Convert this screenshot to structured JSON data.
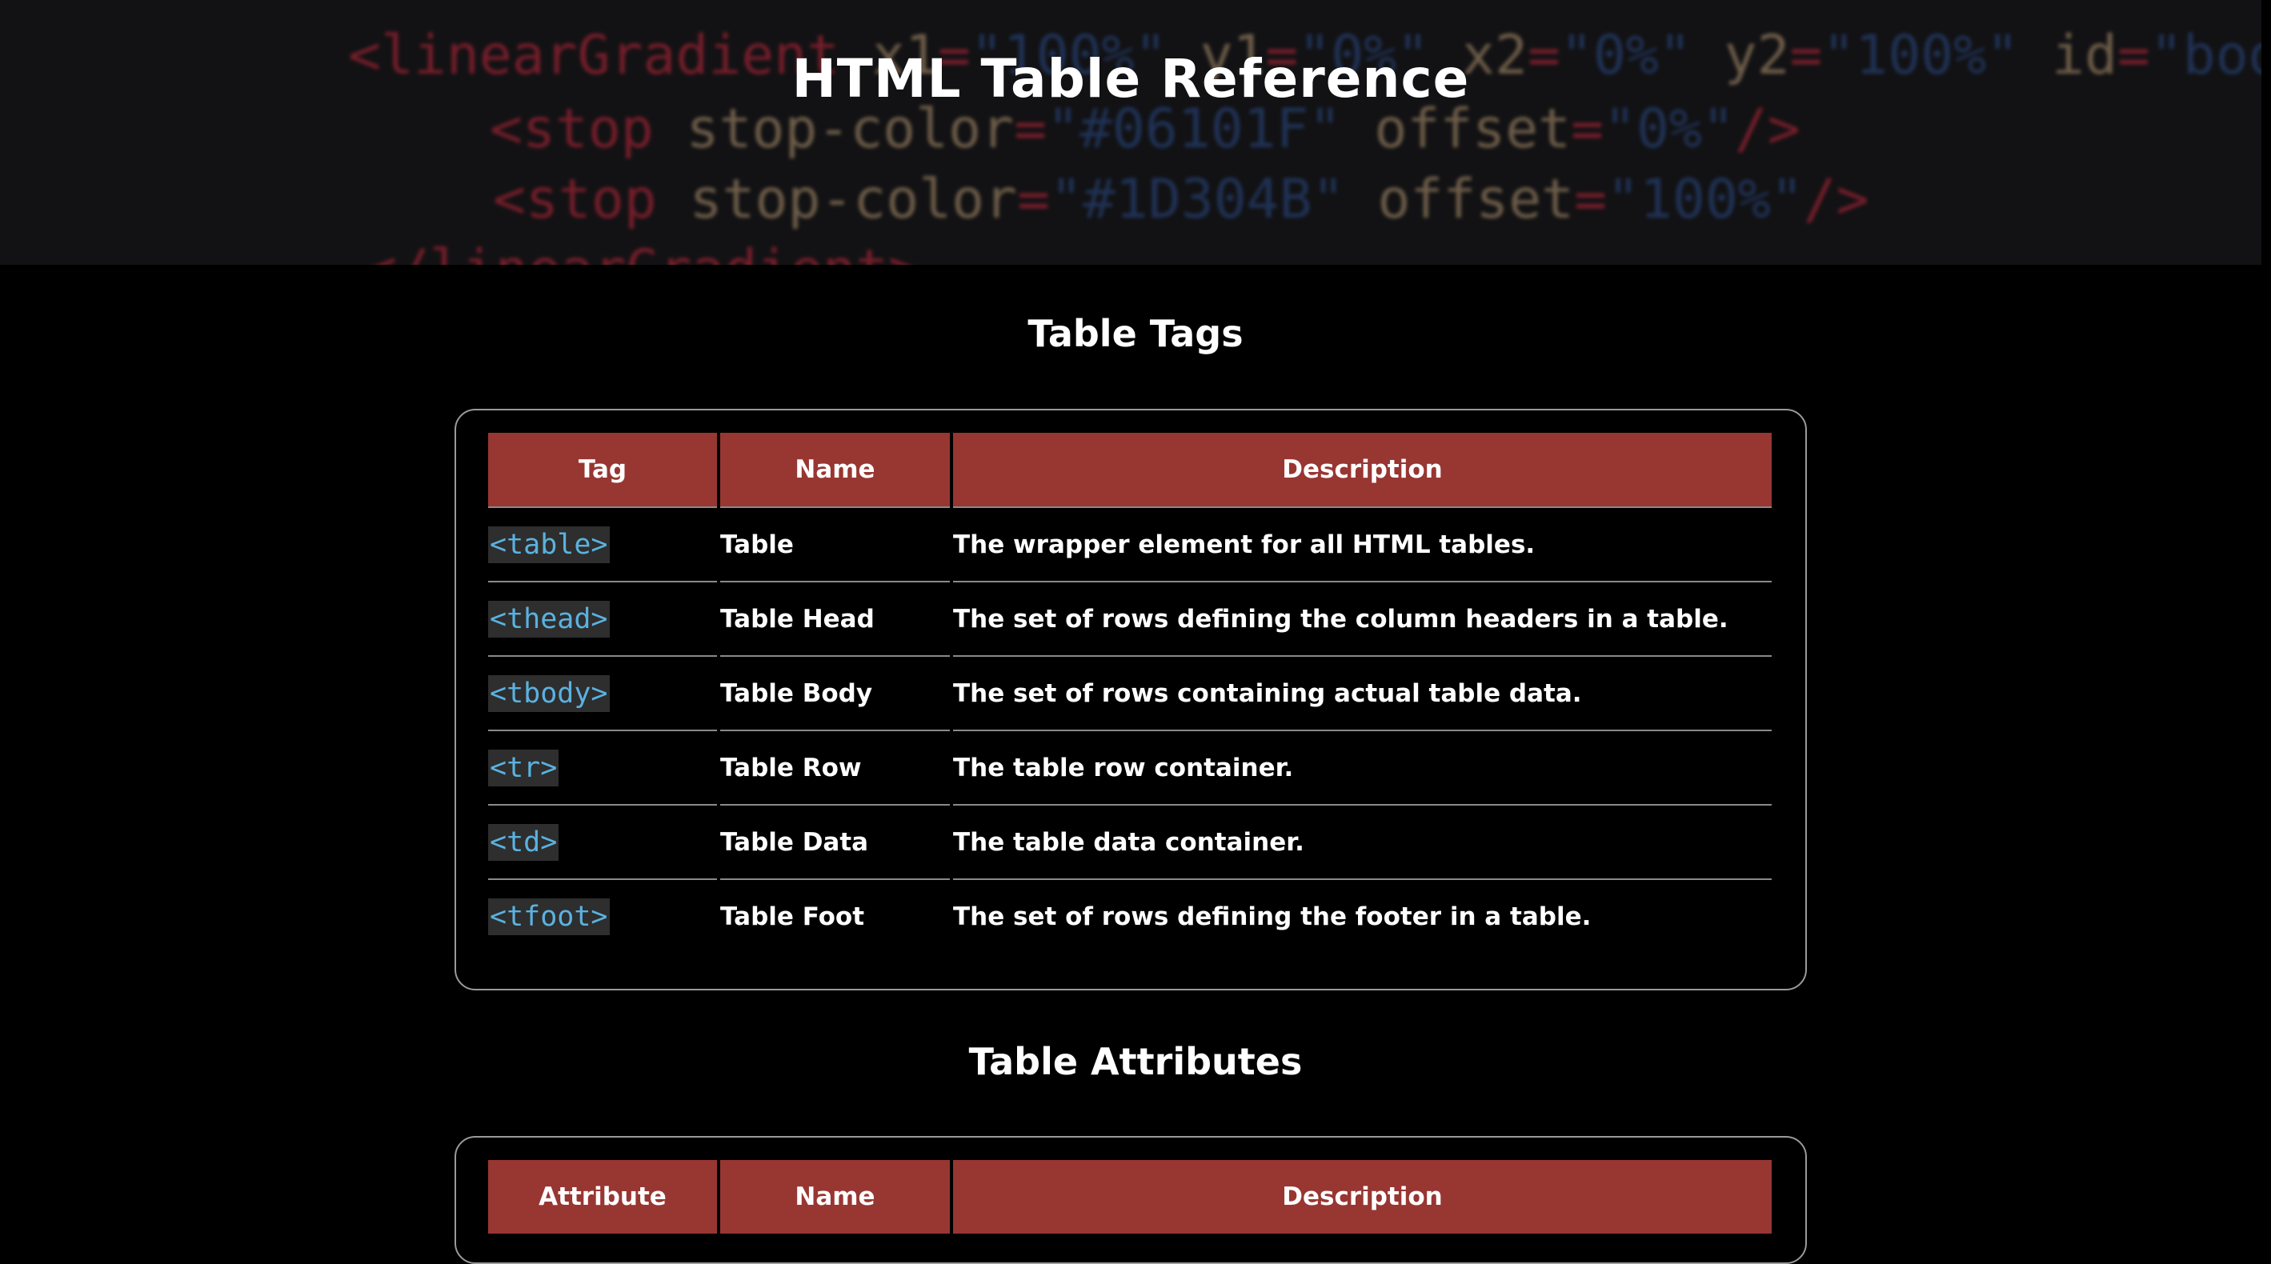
{
  "header": {
    "title": "HTML Table Reference",
    "background_code": [
      "<linearGradient x1=\"100%\" y1=\"0%\" x2=\"0%\" y2=\"100%\" id=\"bodyGradient\">",
      "<stop stop-color=\"#06101F\" offset=\"0%\"/>",
      "<stop stop-color=\"#1D304B\" offset=\"100%\"/>",
      "</linearGradient>"
    ]
  },
  "tags_section": {
    "title": "Table Tags",
    "columns": [
      "Tag",
      "Name",
      "Description"
    ],
    "rows": [
      {
        "tag": "<table>",
        "name": "Table",
        "description": "The wrapper element for all HTML tables."
      },
      {
        "tag": "<thead>",
        "name": "Table Head",
        "description": "The set of rows defining the column headers in a table."
      },
      {
        "tag": "<tbody>",
        "name": "Table Body",
        "description": "The set of rows containing actual table data."
      },
      {
        "tag": "<tr>",
        "name": "Table Row",
        "description": "The table row container."
      },
      {
        "tag": "<td>",
        "name": "Table Data",
        "description": "The table data container."
      },
      {
        "tag": "<tfoot>",
        "name": "Table Foot",
        "description": "The set of rows defining the footer in a table."
      }
    ]
  },
  "attributes_section": {
    "title": "Table Attributes",
    "columns": [
      "Attribute",
      "Name",
      "Description"
    ]
  },
  "colors": {
    "header_cell": "#983632",
    "code_text": "#5ab2e0",
    "code_bg": "#2e2e2e"
  }
}
